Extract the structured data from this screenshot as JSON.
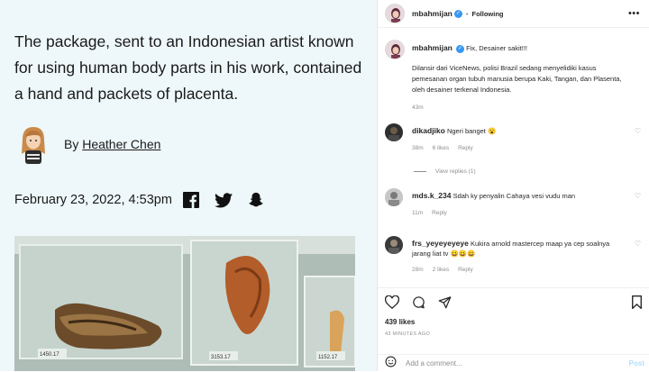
{
  "article": {
    "headline": "The package, sent to an Indonesian artist known for using human body parts in his work, contained a hand and packets of placenta.",
    "by_prefix": "By",
    "author": "Heather Chen",
    "date": "February 23, 2022, 4:53pm",
    "share_icons": [
      "facebook-icon",
      "twitter-icon",
      "snapchat-icon"
    ],
    "photo_labels": [
      "1450.17",
      "3153.17",
      "1152.17"
    ]
  },
  "post": {
    "username": "mbahmijan",
    "following": "Following",
    "dot": "•",
    "more": "•••",
    "caption_first": "Fix, Desainer sakit!!!",
    "caption_body": "Dilansir dari ViceNews, polisi Brazil sedang menyelidiki kasus pemesanan organ tubuh manusia berupa Kaki, Tangan, dan Plasenta, oleh desainer terkenal Indonesia.",
    "caption_time": "43m",
    "likes": "439 likes",
    "posted_ago": "43 MINUTES AGO",
    "add_comment_placeholder": "Add a comment...",
    "post_button": "Post"
  },
  "comments": [
    {
      "user": "dikadjiko",
      "text": "Ngeri banget 😮",
      "time": "38m",
      "likes": "6 likes",
      "reply": "Reply"
    },
    {
      "user": "mds.k_234",
      "text": "Sdah ky penyalin Cahaya vesi vudu man",
      "time": "11m",
      "likes": "",
      "reply": "Reply"
    },
    {
      "user": "frs_yeyeyeyeye",
      "text": "Kukira arnold mastercep maap ya cep soalnya jarang liat tv 😀😀😀",
      "time": "28m",
      "likes": "2 likes",
      "reply": "Reply"
    }
  ],
  "view_replies": "View replies (1)",
  "colors": {
    "article_bg": "#eef8fa",
    "verified": "#3897f0",
    "post_link": "#b2dffc"
  }
}
